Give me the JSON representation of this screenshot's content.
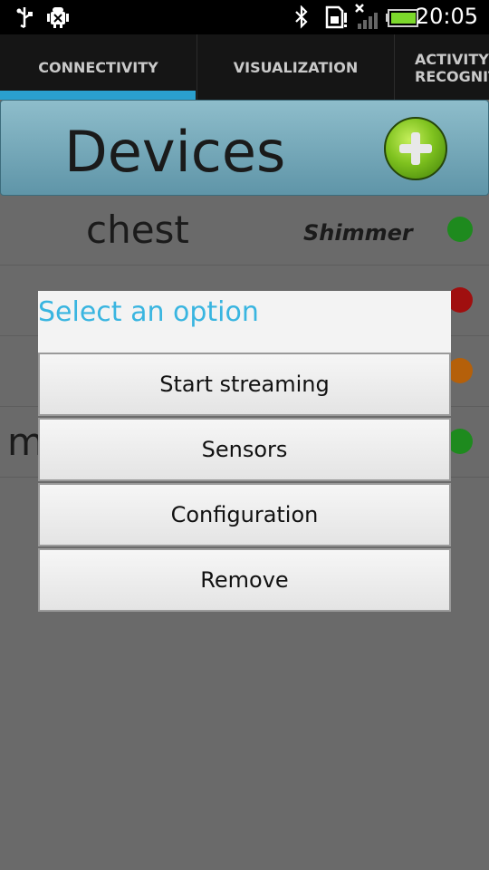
{
  "status_bar": {
    "time": "20:05",
    "icons": [
      "usb-icon",
      "android-debug-icon",
      "bluetooth-icon",
      "sd-card-icon",
      "signal-icon",
      "battery-icon"
    ]
  },
  "tabs": [
    {
      "label": "CONNECTIVITY",
      "active": true
    },
    {
      "label": "VISUALIZATION",
      "active": false
    },
    {
      "label_line1": "ACTIVITY",
      "label_line2": "RECOGNIT",
      "active": false
    }
  ],
  "header": {
    "title": "Devices",
    "add_icon": "plus-icon"
  },
  "devices": [
    {
      "name": "chest",
      "type": "Shimmer",
      "status_color": "#1e8a1e"
    },
    {
      "name": "",
      "type": "",
      "status_color": "#a00f0f"
    },
    {
      "name": "",
      "type": "",
      "status_color": "#b5600a"
    },
    {
      "name": "m",
      "type": "",
      "status_color": "#1e8a1e"
    }
  ],
  "dialog": {
    "title": "Select an option",
    "options": [
      "Start streaming",
      "Sensors",
      "Configuration",
      "Remove"
    ]
  },
  "colors": {
    "accent": "#39b5e0",
    "tab_indicator": "#2aa0cf"
  }
}
